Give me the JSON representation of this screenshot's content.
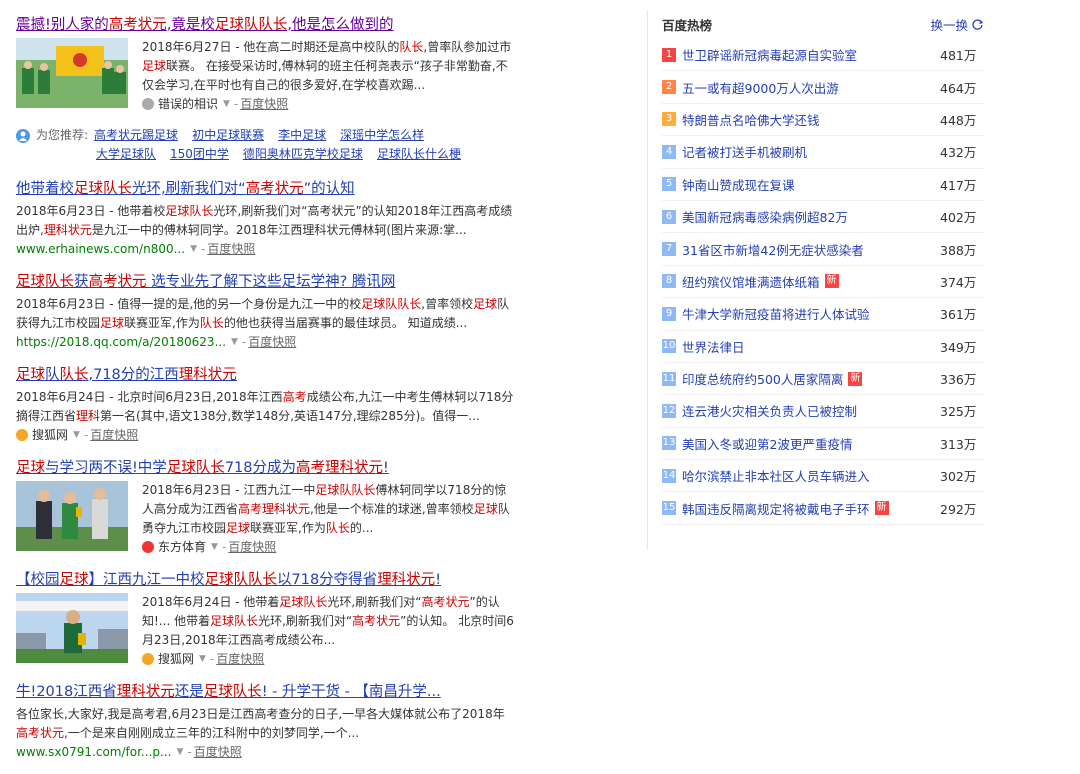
{
  "results": [
    {
      "title_parts": [
        [
          "震撼!别人家的",
          0
        ],
        [
          "高考状元",
          1
        ],
        [
          ",竟是校",
          0
        ],
        [
          "足球队队长",
          1
        ],
        [
          ",他是怎么做到的",
          0
        ]
      ],
      "visited": true,
      "thumb": "team",
      "abstract_parts": [
        [
          "2018年6月27日 - 他在高二时期还是高中校队的",
          0
        ],
        [
          "队长",
          1
        ],
        [
          ",曾率队参加过市",
          0
        ],
        [
          "足球",
          1
        ],
        [
          "联赛。 在接受采访时,傅林轲的班主任柯尧表示“孩子非常勤奋,不仅会学习,在平时也有自己的很多爱好,在学校喜欢踢...",
          0
        ]
      ],
      "source": "错误的相识",
      "snapshot": "百度快照"
    },
    {
      "title_parts": [
        [
          "他带着校",
          0
        ],
        [
          "足球队长",
          1
        ],
        [
          "光环,刷新我们对“",
          0
        ],
        [
          "高考状元",
          1
        ],
        [
          "”的认知",
          0
        ]
      ],
      "visited": false,
      "thumb": "",
      "abstract_parts": [
        [
          "2018年6月23日 - 他带着校",
          0
        ],
        [
          "足球队长",
          1
        ],
        [
          "光环,刷新我们对“高考状元”的认知2018年江西高考成绩出炉,",
          0
        ],
        [
          "理科状元",
          1
        ],
        [
          "是九江一中的傅林轲同学。2018年江西理科状元傅林轲(图片来源:掌...",
          0
        ]
      ],
      "url": "www.erhainews.com/n800...",
      "snapshot": "百度快照"
    },
    {
      "title_parts": [
        [
          "足球队长",
          1
        ],
        [
          "获",
          0
        ],
        [
          "高考状元",
          1
        ],
        [
          " 选专业先了解下这些足坛学神? 腾讯网",
          0
        ]
      ],
      "visited": false,
      "thumb": "",
      "abstract_parts": [
        [
          "2018年6月23日 - 值得一提的是,他的另一个身份是九江一中的校",
          0
        ],
        [
          "足球队队长",
          1
        ],
        [
          ",曾率领校",
          0
        ],
        [
          "足球",
          1
        ],
        [
          "队获得九江市校园",
          0
        ],
        [
          "足球",
          1
        ],
        [
          "联赛亚军,作为",
          0
        ],
        [
          "队长",
          1
        ],
        [
          "的他也获得当届赛事的最佳球员。 知道成绩...",
          0
        ]
      ],
      "url": "https://2018.qq.com/a/20180623...",
      "snapshot": "百度快照"
    },
    {
      "title_parts": [
        [
          "足球",
          1
        ],
        [
          "队",
          0
        ],
        [
          "队长",
          1
        ],
        [
          ",718分的江西",
          0
        ],
        [
          "理科状元",
          1
        ]
      ],
      "visited": false,
      "thumb": "",
      "abstract_parts": [
        [
          "2018年6月24日 - 北京时间6月23日,2018年江西",
          0
        ],
        [
          "高考",
          1
        ],
        [
          "成绩公布,九江一中考生傅林轲以718分摘得江西省",
          0
        ],
        [
          "理科",
          1
        ],
        [
          "第一名(其中,语文138分,数学148分,英语147分,理综285分)。值得一...",
          0
        ]
      ],
      "source": "搜狐网",
      "snapshot": "百度快照"
    },
    {
      "title_parts": [
        [
          "足球",
          1
        ],
        [
          "与学习两不误!中学",
          0
        ],
        [
          "足球队长",
          1
        ],
        [
          "718分成为",
          0
        ],
        [
          "高考理科状元",
          1
        ],
        [
          "!",
          0
        ]
      ],
      "visited": false,
      "thumb": "award",
      "abstract_parts": [
        [
          "2018年6月23日 - 江西九江一中",
          0
        ],
        [
          "足球队队长",
          1
        ],
        [
          "傅林轲同学以718分的惊人高分成为江西省",
          0
        ],
        [
          "高考",
          1
        ],
        [
          "理科状元",
          1
        ],
        [
          ",他是一个标准的球迷,曾率领校",
          0
        ],
        [
          "足球",
          1
        ],
        [
          "队勇夺九江市校园",
          0
        ],
        [
          "足球",
          1
        ],
        [
          "联赛亚军,作为",
          0
        ],
        [
          "队长",
          1
        ],
        [
          "的...",
          0
        ]
      ],
      "source": "东方体育",
      "snapshot": "百度快照"
    },
    {
      "title_parts": [
        [
          "【校园",
          0
        ],
        [
          "足球",
          1
        ],
        [
          "】江西九江一中校",
          0
        ],
        [
          "足球队队长",
          1
        ],
        [
          "以718分夺得省",
          0
        ],
        [
          "理科状元",
          1
        ],
        [
          "!",
          0
        ]
      ],
      "visited": false,
      "thumb": "boy",
      "abstract_parts": [
        [
          "2018年6月24日 - 他带着",
          0
        ],
        [
          "足球队长",
          1
        ],
        [
          "光环,刷新我们对“",
          0
        ],
        [
          "高考状元",
          1
        ],
        [
          "”的认知!... 他带着",
          0
        ],
        [
          "足球队长",
          1
        ],
        [
          "光环,刷新我们对“",
          0
        ],
        [
          "高考状元",
          1
        ],
        [
          "”的认知。 北京时间6月23日,2018年江西高考成绩公布...",
          0
        ]
      ],
      "source": "搜狐网",
      "snapshot": "百度快照"
    },
    {
      "title_parts": [
        [
          "牛!2018江西省",
          0
        ],
        [
          "理科状元",
          1
        ],
        [
          "还是",
          0
        ],
        [
          "足球队长",
          1
        ],
        [
          "! - 升学干货 - 【南昌升学...",
          0
        ]
      ],
      "visited": false,
      "thumb": "",
      "abstract_parts": [
        [
          "各位家长,大家好,我是高考君,6月23日是江西高考查分的日子,一早各大媒体就公布了2018年",
          0
        ],
        [
          "高考状元",
          1
        ],
        [
          ",一个是来自刚刚成立三年的江科附中的刘梦同学,一个...",
          0
        ]
      ],
      "url": "www.sx0791.com/for...p...",
      "snapshot": "百度快照"
    }
  ],
  "recommend": {
    "label": "为您推荐:",
    "row1": [
      "高考状元踢足球",
      "初中足球联赛",
      "李中足球",
      "深瑶中学怎么样"
    ],
    "row2": [
      "大学足球队",
      "150团中学",
      "德阳奥林匹克学校足球",
      "足球队长什么梗"
    ]
  },
  "hot": {
    "title": "百度热榜",
    "refresh": "换一换",
    "items": [
      {
        "rank": "1",
        "text": "世卫辟谣新冠病毒起源自实验室",
        "num": "481万",
        "new": false,
        "color": "#f54545"
      },
      {
        "rank": "2",
        "text": "五一或有超9000万人次出游",
        "num": "464万",
        "new": false,
        "color": "#ff8547"
      },
      {
        "rank": "3",
        "text": "特朗普点名哈佛大学还钱",
        "num": "448万",
        "new": false,
        "color": "#ffac38"
      },
      {
        "rank": "4",
        "text": "记者被打送手机被刷机",
        "num": "432万",
        "new": false,
        "color": "#8eb9f5"
      },
      {
        "rank": "5",
        "text": "钟南山赞成现在复课",
        "num": "417万",
        "new": false,
        "color": "#8eb9f5"
      },
      {
        "rank": "6",
        "text": "美国新冠病毒感染病例超82万",
        "num": "402万",
        "new": false,
        "color": "#8eb9f5"
      },
      {
        "rank": "7",
        "text": "31省区市新增42例无症状感染者",
        "num": "388万",
        "new": false,
        "color": "#8eb9f5"
      },
      {
        "rank": "8",
        "text": "纽约殡仪馆堆满遗体纸箱",
        "num": "374万",
        "new": true,
        "color": "#8eb9f5"
      },
      {
        "rank": "9",
        "text": "牛津大学新冠疫苗将进行人体试验",
        "num": "361万",
        "new": false,
        "color": "#8eb9f5"
      },
      {
        "rank": "10",
        "text": "世界法律日",
        "num": "349万",
        "new": false,
        "color": "#8eb9f5"
      },
      {
        "rank": "11",
        "text": "印度总统府约500人居家隔离",
        "num": "336万",
        "new": true,
        "color": "#8eb9f5"
      },
      {
        "rank": "12",
        "text": "连云港火灾相关负责人已被控制",
        "num": "325万",
        "new": false,
        "color": "#8eb9f5"
      },
      {
        "rank": "13",
        "text": "美国入冬或迎第2波更严重疫情",
        "num": "313万",
        "new": false,
        "color": "#8eb9f5"
      },
      {
        "rank": "14",
        "text": "哈尔滨禁止非本社区人员车辆进入",
        "num": "302万",
        "new": false,
        "color": "#8eb9f5"
      },
      {
        "rank": "15",
        "text": "韩国违反隔离规定将被戴电子手环",
        "num": "292万",
        "new": true,
        "color": "#8eb9f5"
      }
    ],
    "new_label": "新"
  }
}
